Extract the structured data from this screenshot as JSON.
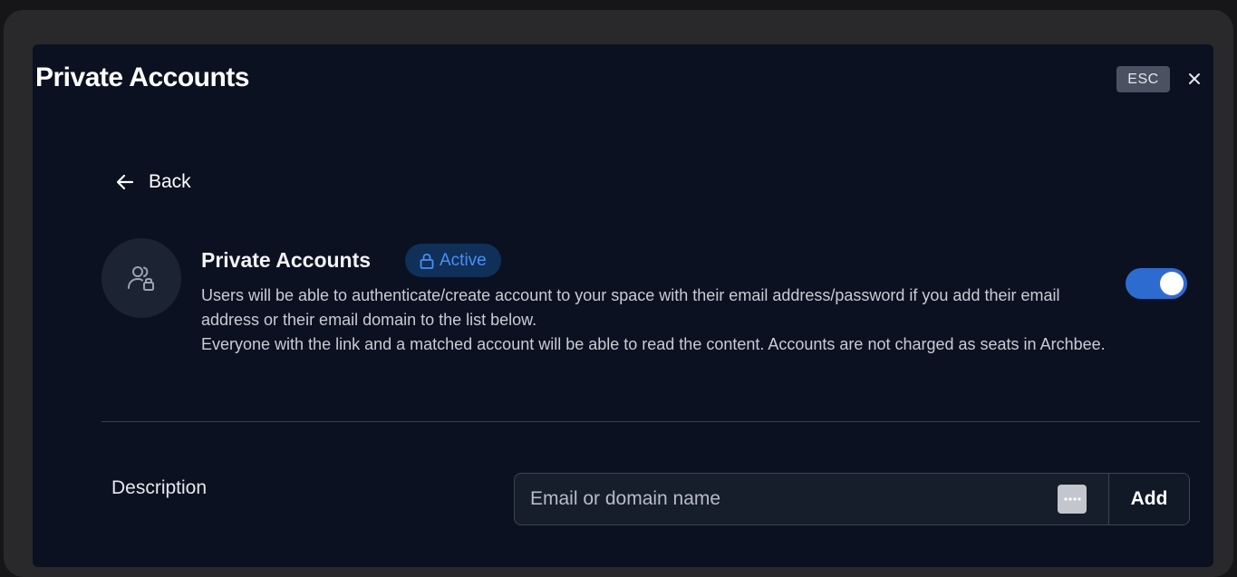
{
  "modal": {
    "title": "Private Accounts",
    "esc_label": "ESC"
  },
  "back": {
    "label": "Back"
  },
  "section": {
    "title": "Private Accounts",
    "status": "Active",
    "description_1": "Users will be able to authenticate/create account to your space with their email address/password if you add their email address or their email domain to the list below.",
    "description_2": "Everyone with the link and a matched account will be able to read the content. Accounts are not charged as seats in Archbee.",
    "toggle_on": true
  },
  "form": {
    "label": "Description",
    "input_placeholder": "Email or domain name",
    "input_value": "",
    "add_label": "Add"
  },
  "colors": {
    "accent": "#2e6bd0",
    "badge_text": "#4b8ff0",
    "badge_bg": "#10305a",
    "modal_bg": "#0b1120"
  },
  "icons": {
    "close": "close-icon",
    "back": "arrow-left-icon",
    "avatar": "users-lock-icon",
    "badge": "lock-icon",
    "password_manager": "password-manager-icon"
  }
}
